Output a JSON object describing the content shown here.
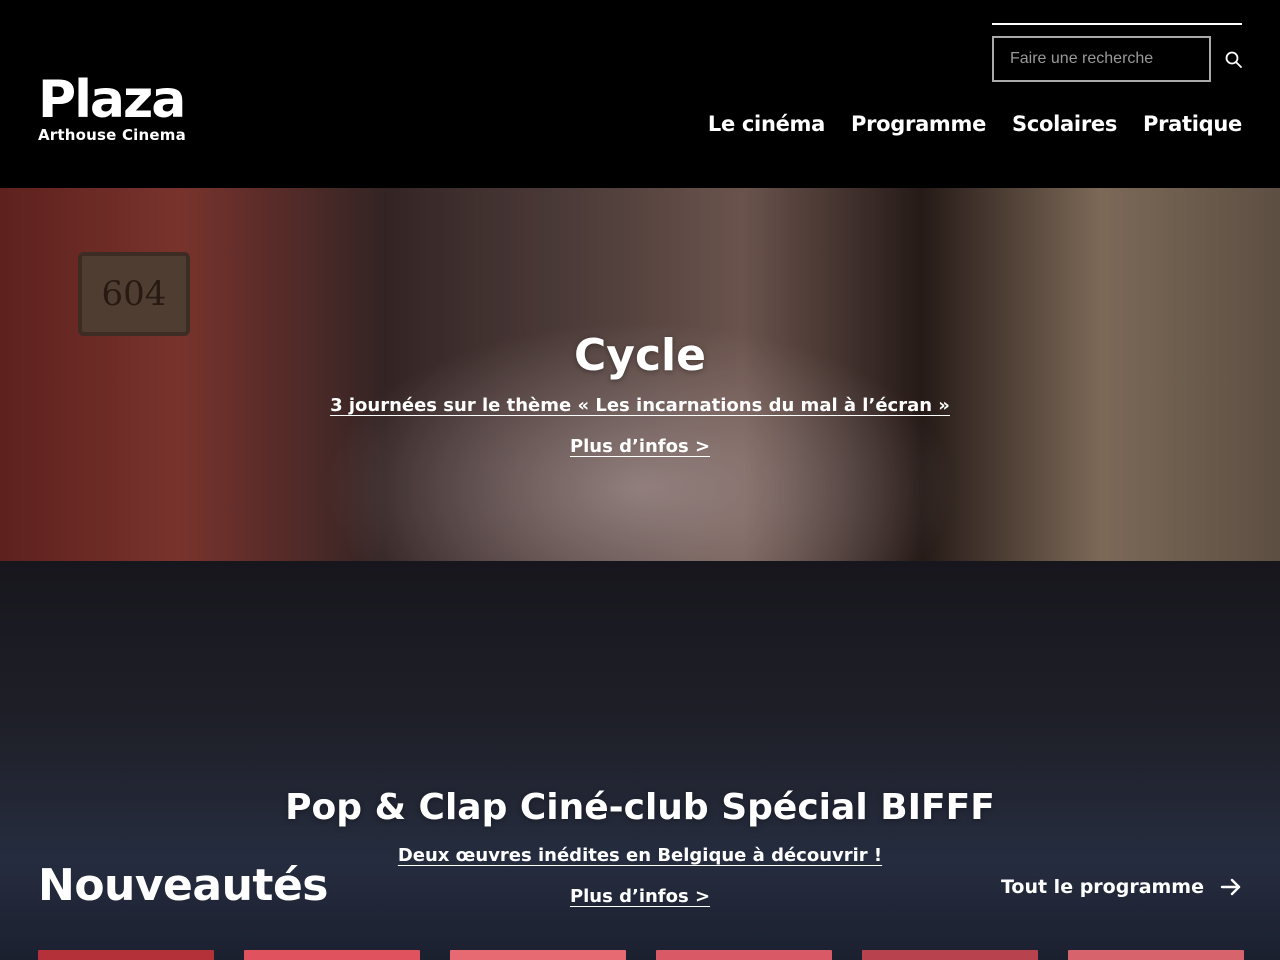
{
  "header": {
    "logo_title": "Plaza",
    "logo_subtitle": "Arthouse Cinema",
    "search_placeholder": "Faire une recherche",
    "search_icon": "search-icon",
    "nav": [
      {
        "label": "Le cinéma"
      },
      {
        "label": "Programme"
      },
      {
        "label": "Scolaires"
      },
      {
        "label": "Pratique"
      }
    ]
  },
  "banners": [
    {
      "title": "Cycle",
      "subtitle": "3 journées sur le thème « Les incarnations du mal à l’écran »",
      "link": "Plus d’infos >",
      "plate_text": "604"
    },
    {
      "title": "Pop & Clap Ciné-club Spécial BIFFF",
      "subtitle": "Deux œuvres inédites en Belgique à découvrir !",
      "link": "Plus d’infos >"
    }
  ],
  "new_releases": {
    "title": "Nouveautés",
    "all_link": "Tout le programme",
    "arrow_icon": "arrow-right-icon",
    "poster_colors": [
      "#b4313a",
      "#e0525e",
      "#e76a72",
      "#d95a66",
      "#b8434e",
      "#d7646c"
    ]
  },
  "colors": {
    "background": "#000000",
    "text": "#ffffff"
  }
}
